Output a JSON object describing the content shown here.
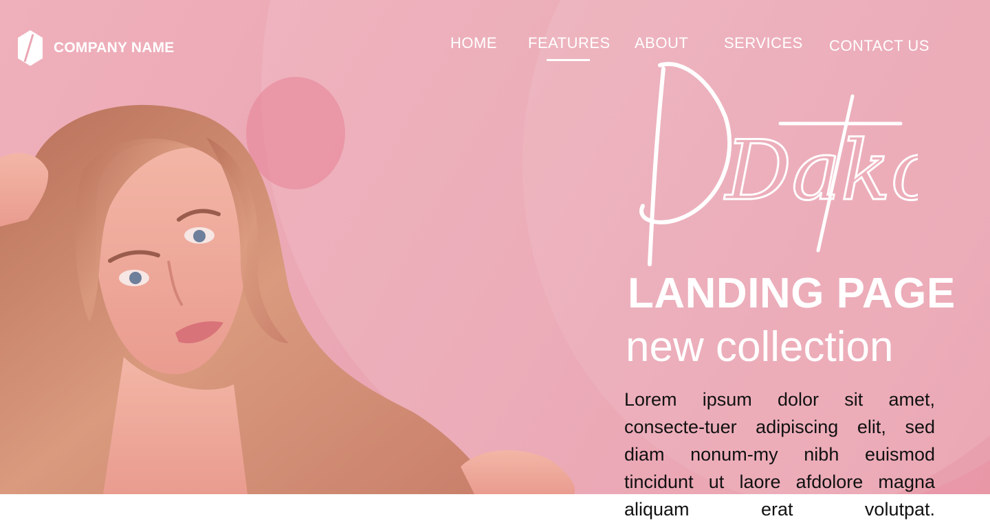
{
  "brand": {
    "name": "COMPANY NAME",
    "icon": "hexagon-logo-icon"
  },
  "nav": {
    "items": [
      "HOME",
      "FEATURES",
      "ABOUT",
      "SERVICES",
      "CONTACT US"
    ],
    "active": "FEATURES"
  },
  "hero": {
    "script_title": "Dakota",
    "headline": "LANDING PAGE",
    "subheadline": "new collection",
    "body": "Lorem ipsum dolor sit amet, consecte-tuer adipiscing elit, sed diam nonum-my nibh euismod tincidunt ut laore afdolore magna aliquam erat volutpat."
  },
  "colors": {
    "background": "#eaa6b3",
    "accent": "#ffffff",
    "text_dark": "#111111"
  }
}
